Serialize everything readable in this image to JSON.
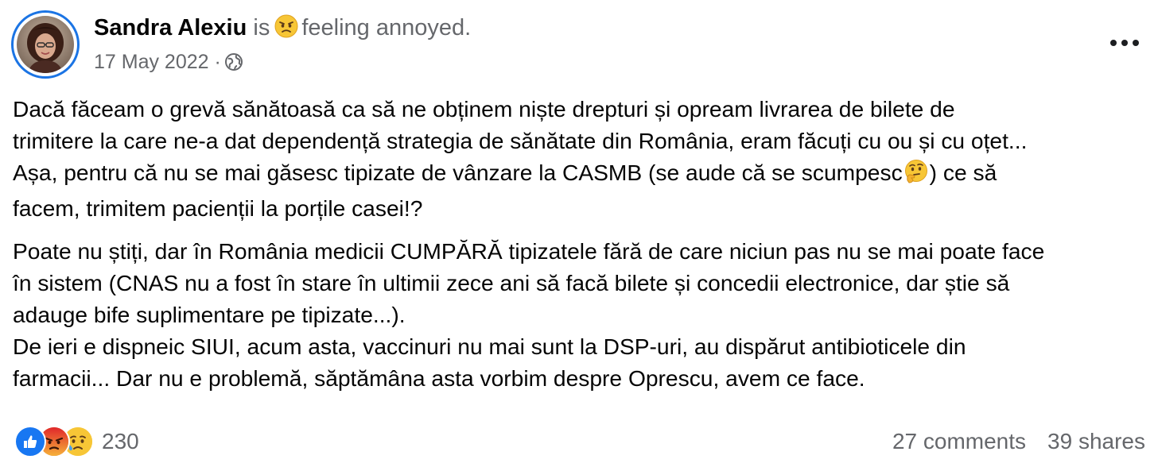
{
  "post": {
    "author": {
      "name": "Sandra Alexiu",
      "connector": "is",
      "feeling": "feeling annoyed.",
      "feeling_icon": "unamused-face-emoji",
      "avatar_icon": "profile-photo"
    },
    "meta": {
      "date": "17 May 2022",
      "separator": "·",
      "privacy_icon": "globe-icon"
    },
    "menu_icon": "more-options-icon",
    "body": {
      "p1": [
        "Dacă făceam o grevă sănătoasă ca să ne obținem niște drepturi și opream livrarea de bilete de",
        "trimitere la care ne-a dat dependență strategia de sănătate din România, eram făcuți cu ou și cu oțet...",
        "Așa, pentru că nu se mai găsesc tipizate de vânzare la CASMB (se aude că se scumpesc",
        ") ce să",
        "facem, trimitem pacienții la porțile casei!?"
      ],
      "p1_inline_icon": "thinking-face-emoji",
      "p2": [
        "Poate nu știți, dar în România medicii CUMPĂRĂ tipizatele fără de care niciun pas nu se mai poate face",
        "în sistem (CNAS nu a fost în stare în ultimii zece ani să facă bilete și concedii electronice, dar știe să",
        "adauge bife suplimentare pe tipizate...).",
        "De ieri e dispneic SIUI, acum asta, vaccinuri nu mai sunt la DSP-uri, au dispărut antibioticele din",
        "farmacii... Dar nu e problemă, săptămâna asta vorbim despre Oprescu, avem ce face."
      ]
    },
    "footer": {
      "reactions": [
        "like-icon",
        "angry-face-icon",
        "sad-face-icon"
      ],
      "reaction_count": "230",
      "comments": "27 comments",
      "shares": "39 shares"
    },
    "colors": {
      "text": "#050505",
      "secondary": "#65676b",
      "like_blue": "#1877f2",
      "ring_blue": "#1b74e4"
    }
  }
}
